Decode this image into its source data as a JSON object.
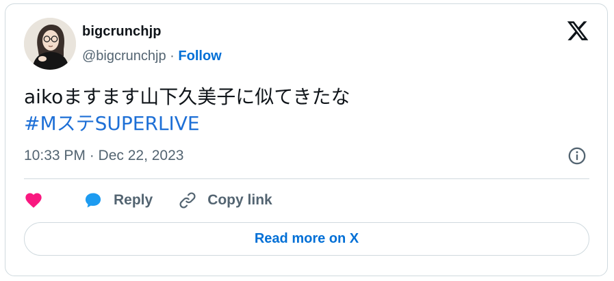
{
  "author": {
    "display_name": "bigcrunchjp",
    "handle": "@bigcrunchjp",
    "separator": "·",
    "follow_label": "Follow"
  },
  "tweet": {
    "text": "aikoますます山下久美子に似てきたな",
    "hashtag": "#MステSUPERLIVE",
    "timestamp": "10:33 PM · Dec 22, 2023"
  },
  "actions": {
    "like_icon": "heart-icon",
    "reply_label": "Reply",
    "reply_icon": "speech-bubble-icon",
    "copy_label": "Copy link",
    "copy_icon": "link-icon"
  },
  "read_more_label": "Read more on X",
  "icons": {
    "brand": "x-logo-icon",
    "info": "info-icon"
  },
  "colors": {
    "link_blue": "#006fd6",
    "hashtag_blue": "#1d6fd6",
    "like_pink": "#f91880",
    "reply_blue": "#1d9bf0",
    "text_primary": "#0f1419",
    "text_secondary": "#536471",
    "border": "#cfd9de"
  }
}
